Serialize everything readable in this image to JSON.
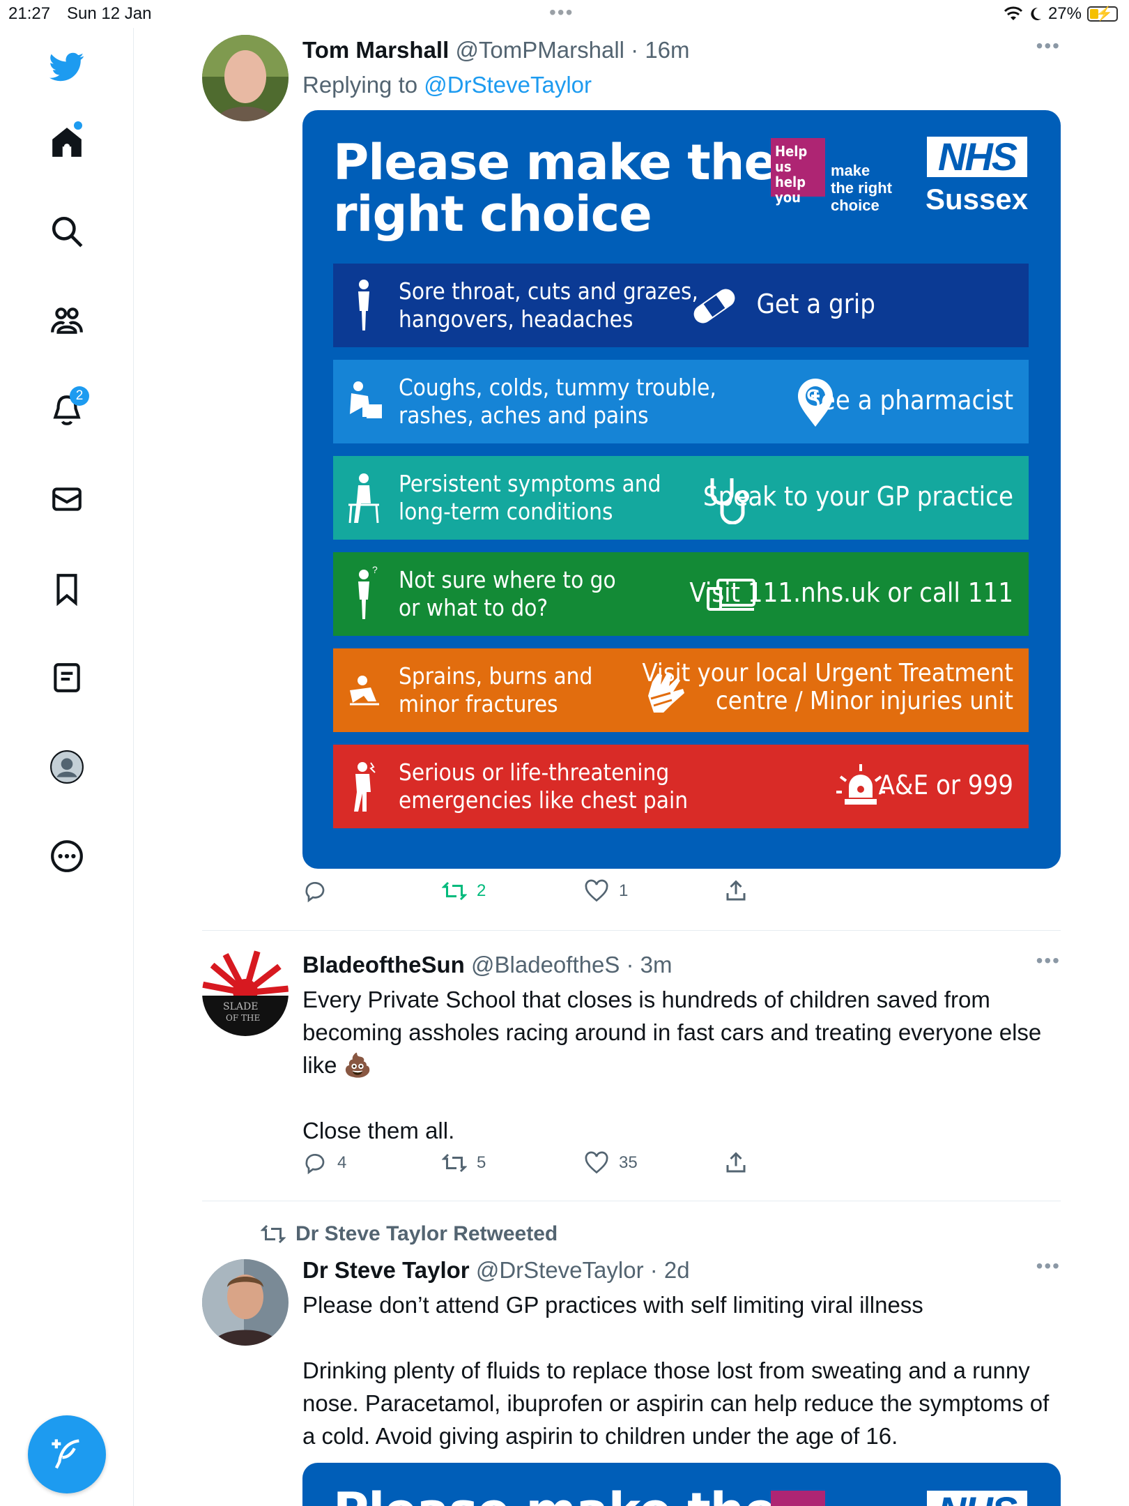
{
  "status_bar": {
    "time": "21:27",
    "date": "Sun 12 Jan",
    "battery": "27%"
  },
  "sidebar": {
    "notifications_badge": "2",
    "items": [
      "home-icon",
      "search-icon",
      "communities-icon",
      "bell-icon",
      "mail-icon",
      "bookmark-icon",
      "lists-icon",
      "profile-icon",
      "more-icon"
    ]
  },
  "tweets": [
    {
      "name": "Tom Marshall",
      "handle": "@TomPMarshall",
      "time": "· 16m",
      "replying_prefix": "Replying to ",
      "replying_to": "@DrSteveTaylor",
      "replies": "",
      "retweets": "2",
      "likes": "1"
    },
    {
      "name": "BladeoftheSun",
      "handle": "@BladeoftheS",
      "time": "· 3m",
      "text": "Every Private School that closes is hundreds of children saved from becoming assholes racing around in fast cars and treating everyone else like 💩\n\nClose them all.",
      "replies": "4",
      "retweets": "5",
      "likes": "35"
    },
    {
      "retweeted_by": "Dr Steve Taylor Retweeted",
      "name": "Dr Steve Taylor",
      "handle": "@DrSteveTaylor",
      "time": "· 2d",
      "text": "Please don’t attend GP practices with self limiting viral illness\n\nDrinking plenty of fluids to replace those lost from sweating and a runny nose. Paracetamol, ibuprofen or aspirin can help reduce the symptoms of a cold. Avoid giving aspirin to children under the age of 16."
    }
  ],
  "poster": {
    "title_line1": "Please make the",
    "title_line2": "right choice",
    "help_line1": "Help us",
    "help_line2": "help you",
    "make_line1": "make",
    "make_line2": "the right",
    "make_line3": "choice",
    "nhs": "NHS",
    "region": "Sussex",
    "rows": [
      {
        "symptom1": "Sore throat, cuts and grazes,",
        "symptom2": "hangovers, headaches",
        "action1": "Get a grip",
        "action2": "",
        "color": "#0b3a94"
      },
      {
        "symptom1": "Coughs, colds, tummy trouble,",
        "symptom2": "rashes, aches and pains",
        "action1": "See a pharmacist",
        "action2": "",
        "color": "#1684d6"
      },
      {
        "symptom1": "Persistent symptoms and",
        "symptom2": "long-term conditions",
        "action1": "Speak to your GP practice",
        "action2": "",
        "color": "#14a89e"
      },
      {
        "symptom1": "Not sure where to go",
        "symptom2": "or what to do?",
        "action1": "Visit 111.nhs.uk or call 111",
        "action2": "",
        "color": "#138a36"
      },
      {
        "symptom1": "Sprains, burns and",
        "symptom2": "minor fractures",
        "action1": "Visit your local Urgent Treatment",
        "action2": "centre / Minor injuries unit",
        "color": "#e26d0e"
      },
      {
        "symptom1": "Serious or life-threatening",
        "symptom2": "emergencies like chest pain",
        "action1": "A&E or 999",
        "action2": "",
        "color": "#d92b27"
      }
    ],
    "bottom_peek_title": "Please make the",
    "bottom_peek_nhs": "NHS"
  },
  "colors": {
    "accent": "#1d9bf0",
    "retweet": "#00ba7c",
    "nhs_blue": "#005eb8"
  }
}
